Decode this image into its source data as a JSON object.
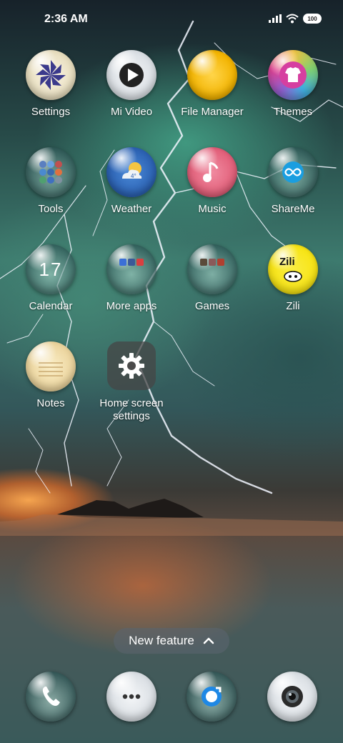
{
  "status_bar": {
    "time": "2:36 AM",
    "battery": "100",
    "icons": [
      "signal-icon",
      "wifi-icon",
      "battery-icon"
    ]
  },
  "apps": [
    {
      "label": "Settings",
      "icon": "pinwheel-icon"
    },
    {
      "label": "Mi Video",
      "icon": "play-icon"
    },
    {
      "label": "File Manager",
      "icon": "folder-icon"
    },
    {
      "label": "Themes",
      "icon": "tshirt-icon"
    },
    {
      "label": "Tools",
      "icon": "tools-grid-icon"
    },
    {
      "label": "Weather",
      "icon": "weather-icon"
    },
    {
      "label": "Music",
      "icon": "music-note-icon"
    },
    {
      "label": "ShareMe",
      "icon": "infinity-icon"
    },
    {
      "label": "Calendar",
      "icon": "calendar-icon",
      "date": "17"
    },
    {
      "label": "More apps",
      "icon": "more-apps-folder-icon"
    },
    {
      "label": "Games",
      "icon": "games-folder-icon"
    },
    {
      "label": "Zili",
      "icon": "zili-icon",
      "badge_text": "Zili"
    },
    {
      "label": "Notes",
      "icon": "notes-icon"
    },
    {
      "label": "Home screen settings",
      "label_line1": "Home screen",
      "label_line2": "settings",
      "icon": "gear-icon"
    }
  ],
  "new_feature": {
    "label": "New feature",
    "icon": "chevron-up-icon"
  },
  "dock": [
    {
      "name": "phone",
      "icon": "phone-icon"
    },
    {
      "name": "messages",
      "icon": "chat-bubble-icon"
    },
    {
      "name": "browser",
      "icon": "browser-icon"
    },
    {
      "name": "camera",
      "icon": "camera-icon"
    }
  ],
  "colors": {
    "file_manager": "#f2b300",
    "themes": "#d63fa0",
    "music": "#e2607a",
    "weather": "#2a5fb0",
    "zili": "#f7e415"
  }
}
